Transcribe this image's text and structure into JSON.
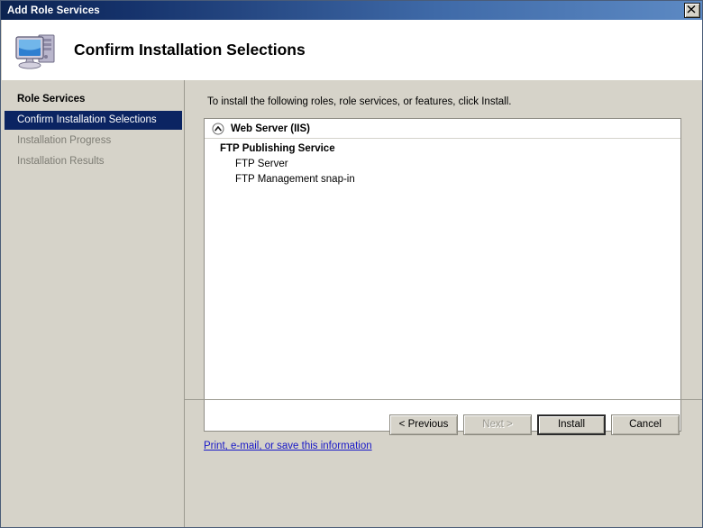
{
  "window": {
    "title": "Add Role Services",
    "close_label": "×",
    "close_icon": "close-icon"
  },
  "header": {
    "title": "Confirm Installation Selections",
    "icon": "computer-icon"
  },
  "sidebar": {
    "items": [
      {
        "label": "Role Services",
        "state": "head"
      },
      {
        "label": "Confirm Installation Selections",
        "state": "selected"
      },
      {
        "label": "Installation Progress",
        "state": "disabled"
      },
      {
        "label": "Installation Results",
        "state": "disabled"
      }
    ]
  },
  "content": {
    "instruction": "To install the following roles, role services, or features, click Install.",
    "role": {
      "name": "Web Server (IIS)",
      "collapse_icon": "chevron-up-circle-icon",
      "items": [
        {
          "label": "FTP Publishing Service",
          "level": 1
        },
        {
          "label": "FTP Server",
          "level": 2
        },
        {
          "label": "FTP Management snap-in",
          "level": 2
        }
      ]
    },
    "info_link": "Print, e-mail, or save this information"
  },
  "footer": {
    "previous": "< Previous",
    "next": "Next >",
    "install": "Install",
    "cancel": "Cancel"
  },
  "colors": {
    "titlebar_start": "#0c2350",
    "titlebar_end": "#5d8ac4",
    "panel_bg": "#d6d3c9",
    "selected_bg": "#0b2462",
    "link": "#1818c8",
    "disabled_text": "#7d7c74"
  }
}
